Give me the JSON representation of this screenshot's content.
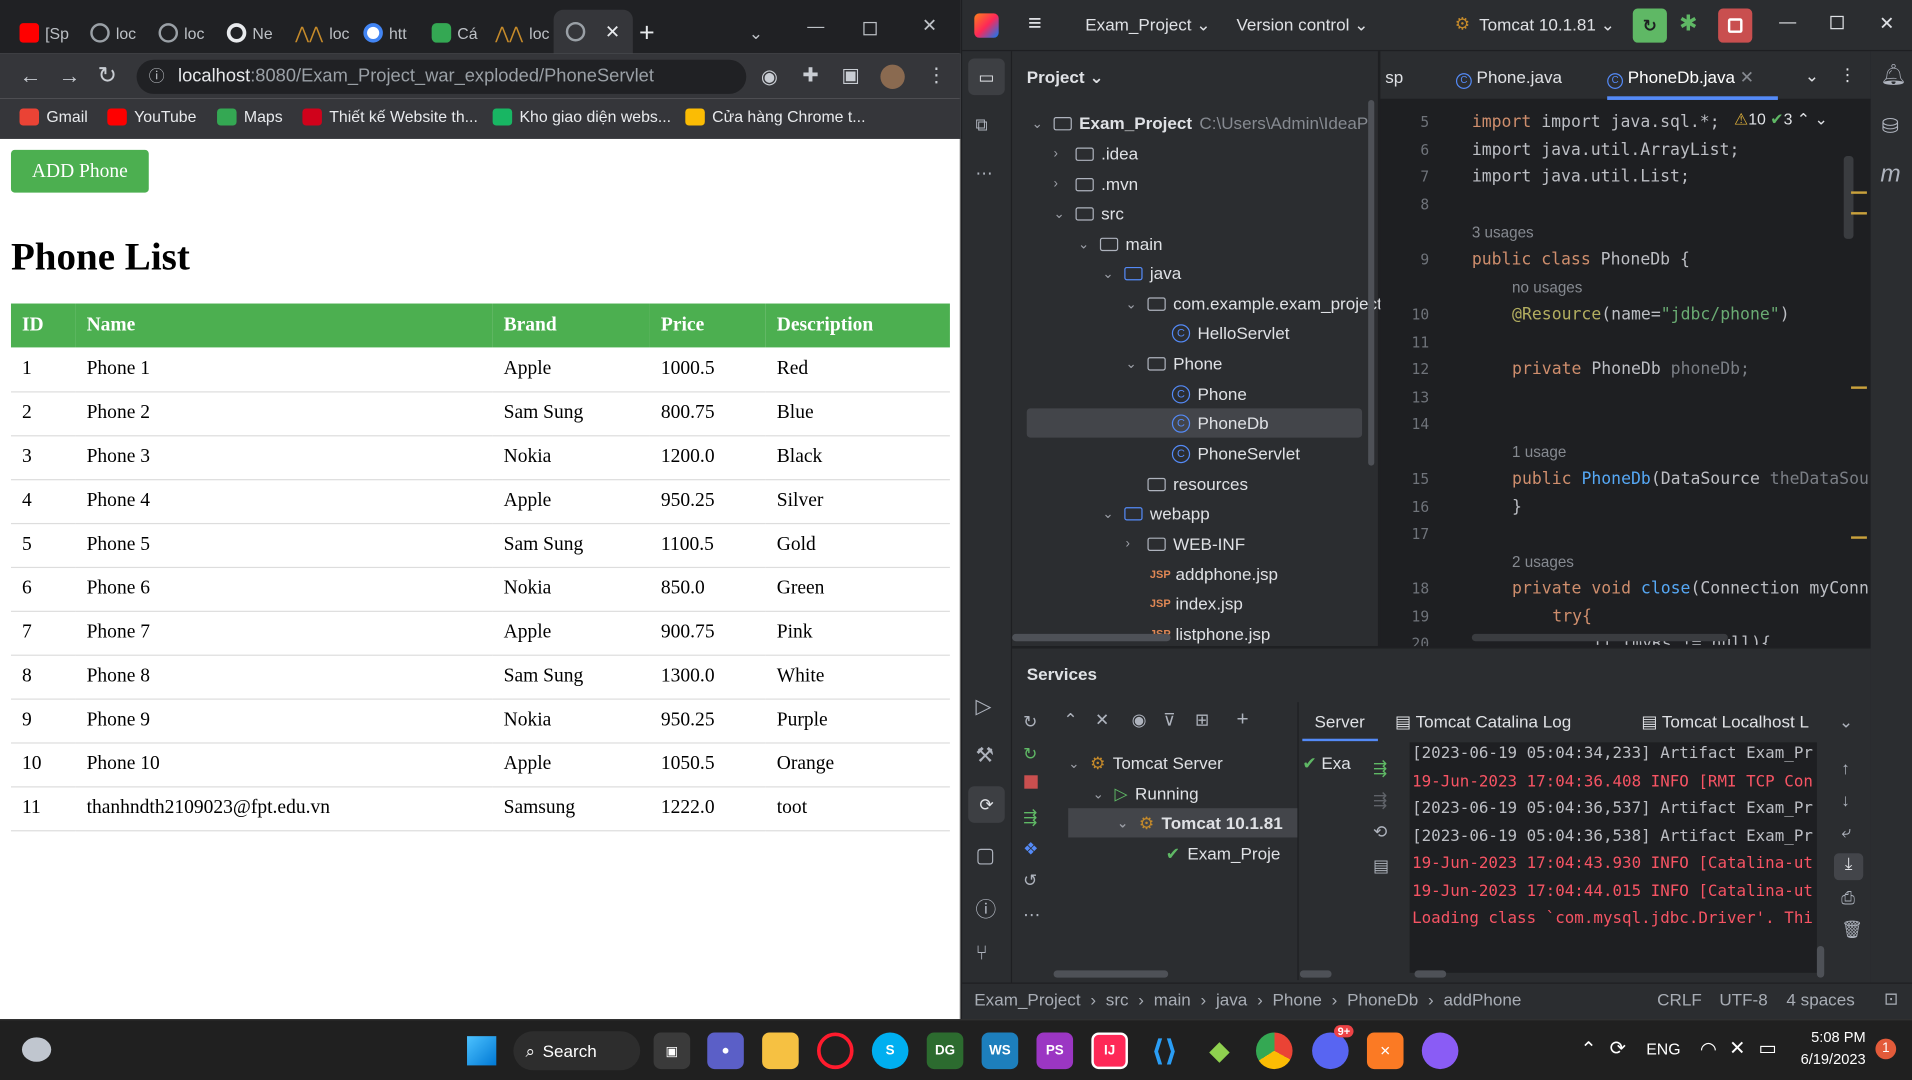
{
  "browser": {
    "tabs": [
      {
        "label": "[Sp",
        "color": "#ff0000"
      },
      {
        "label": "loc",
        "color": "#9aa0a6"
      },
      {
        "label": "loc",
        "color": "#9aa0a6"
      },
      {
        "label": "Ne",
        "color": "#e8eaed"
      },
      {
        "label": "loc",
        "color": "#c58a2a"
      },
      {
        "label": "htt",
        "color": "#4285f4"
      },
      {
        "label": "Cá",
        "color": "#34a853"
      },
      {
        "label": "loc",
        "color": "#c58a2a"
      },
      {
        "label": "",
        "color": "#9aa0a6"
      }
    ],
    "url_host": "localhost",
    "url_rest": ":8080/Exam_Project_war_exploded/PhoneServlet",
    "bookmarks": [
      {
        "label": "Gmail",
        "color": "#ea4335"
      },
      {
        "label": "YouTube",
        "color": "#ff0000"
      },
      {
        "label": "Maps",
        "color": "#34a853"
      },
      {
        "label": "Thiết kế Website th...",
        "color": "#d0021b"
      },
      {
        "label": "Kho giao diện webs...",
        "color": "#18b663"
      },
      {
        "label": "Cửa hàng Chrome t...",
        "color": "#fbbc04"
      }
    ]
  },
  "page": {
    "add_button": "ADD Phone",
    "title": "Phone List",
    "columns": [
      "ID",
      "Name",
      "Brand",
      "Price",
      "Description"
    ],
    "rows": [
      [
        "1",
        "Phone 1",
        "Apple",
        "1000.5",
        "Red"
      ],
      [
        "2",
        "Phone 2",
        "Sam Sung",
        "800.75",
        "Blue"
      ],
      [
        "3",
        "Phone 3",
        "Nokia",
        "1200.0",
        "Black"
      ],
      [
        "4",
        "Phone 4",
        "Apple",
        "950.25",
        "Silver"
      ],
      [
        "5",
        "Phone 5",
        "Sam Sung",
        "1100.5",
        "Gold"
      ],
      [
        "6",
        "Phone 6",
        "Nokia",
        "850.0",
        "Green"
      ],
      [
        "7",
        "Phone 7",
        "Apple",
        "900.75",
        "Pink"
      ],
      [
        "8",
        "Phone 8",
        "Sam Sung",
        "1300.0",
        "White"
      ],
      [
        "9",
        "Phone 9",
        "Nokia",
        "950.25",
        "Purple"
      ],
      [
        "10",
        "Phone 10",
        "Apple",
        "1050.5",
        "Orange"
      ],
      [
        "11",
        "thanhndth2109023@fpt.edu.vn",
        "Samsung",
        "1222.0",
        "toot"
      ]
    ]
  },
  "ide": {
    "project_name": "Exam_Project",
    "version_control": "Version control",
    "run_config": "Tomcat 10.1.81",
    "project_label": "Project",
    "tree": [
      {
        "label": "Exam_Project",
        "extra": "C:\\Users\\Admin\\IdeaPr",
        "bold": true
      },
      {
        "label": ".idea"
      },
      {
        "label": ".mvn"
      },
      {
        "label": "src"
      },
      {
        "label": "main"
      },
      {
        "label": "java"
      },
      {
        "label": "com.example.exam_project"
      },
      {
        "label": "HelloServlet"
      },
      {
        "label": "Phone"
      },
      {
        "label": "Phone"
      },
      {
        "label": "PhoneDb"
      },
      {
        "label": "PhoneServlet"
      },
      {
        "label": "resources"
      },
      {
        "label": "webapp"
      },
      {
        "label": "WEB-INF"
      },
      {
        "label": "addphone.jsp"
      },
      {
        "label": "index.jsp"
      },
      {
        "label": "listphone.jsp"
      }
    ],
    "editor_tabs": [
      "sp",
      "Phone.java",
      "PhoneDb.java"
    ],
    "warnings": "10",
    "checks": "3",
    "code": {
      "l5": "import java.sql.*;",
      "l6": "import java.util.ArrayList;",
      "l7": "import java.util.List;",
      "usages3": "3 usages",
      "l9a": "public class ",
      "l9b": "PhoneDb {",
      "nousages": "no usages",
      "l10a": "@Resource",
      "l10b": "(name=",
      "l10c": "\"jdbc/phone\"",
      "l10d": ")",
      "l12a": "private ",
      "l12b": "PhoneDb ",
      "l12c": "phoneDb;",
      "usage1": "1 usage",
      "l15a": "public ",
      "l15b": "PhoneDb",
      "l15c": "(DataSource ",
      "l15d": "theDataSou",
      "l16": "}",
      "usages2": "2 usages",
      "l18a": "private void ",
      "l18b": "close",
      "l18c": "(Connection myConn",
      "l19": "try{",
      "l20": "if (myRs != null){",
      "line_numbers": [
        "5",
        "6",
        "7",
        "8",
        "9",
        "10",
        "11",
        "12",
        "13",
        "14",
        "15",
        "16",
        "17",
        "18",
        "19",
        "20"
      ]
    },
    "services": {
      "title": "Services",
      "server_tab": "Server",
      "tab_catalina": "Tomcat Catalina Log",
      "tab_localhost": "Tomcat Localhost L",
      "tree": [
        "Tomcat Server",
        "Running",
        "Tomcat 10.1.81",
        "Exam_Proje"
      ],
      "deploy": "Exa",
      "logs": [
        {
          "t": "[2023-06-19 05:04:34,233] Artifact Exam_Pr",
          "c": "#bcbec4"
        },
        {
          "t": "19-Jun-2023 17:04:36.408 INFO [RMI TCP Con",
          "c": "#f75464"
        },
        {
          "t": "[2023-06-19 05:04:36,537] Artifact Exam_Pr",
          "c": "#bcbec4"
        },
        {
          "t": "[2023-06-19 05:04:36,538] Artifact Exam_Pr",
          "c": "#bcbec4"
        },
        {
          "t": "19-Jun-2023 17:04:43.930 INFO [Catalina-ut",
          "c": "#f75464"
        },
        {
          "t": "19-Jun-2023 17:04:44.015 INFO [Catalina-ut",
          "c": "#f75464"
        },
        {
          "t": "Loading class `com.mysql.jdbc.Driver'. Thi",
          "c": "#f75464"
        }
      ]
    },
    "breadcrumb": [
      "Exam_Project",
      "src",
      "main",
      "java",
      "Phone",
      "PhoneDb",
      "addPhone"
    ],
    "status": {
      "crlf": "CRLF",
      "enc": "UTF-8",
      "indent": "4 spaces"
    }
  },
  "taskbar": {
    "search": "Search",
    "lang": "ENG",
    "time": "5:08 PM",
    "date": "6/19/2023",
    "notif": "1",
    "discord_badge": "9+"
  }
}
